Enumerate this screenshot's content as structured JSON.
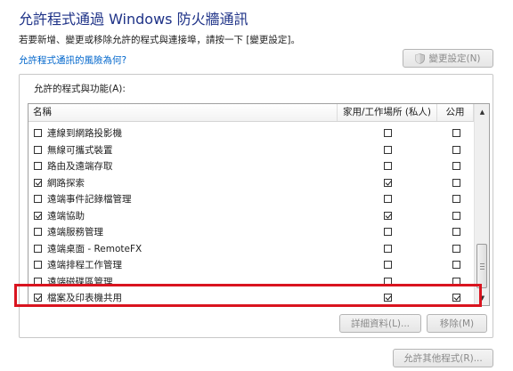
{
  "header": {
    "title": "允許程式通過 Windows 防火牆通訊",
    "subtitle": "若要新增、變更或移除允許的程式與連接埠，請按一下 [變更設定]。",
    "risk_link": "允許程式通訊的風險為何?",
    "change_settings_label": "變更設定(N)"
  },
  "group": {
    "label": "允許的程式與功能(A):",
    "columns": {
      "name": "名稱",
      "private": "家用/工作場所 (私人)",
      "public": "公用"
    },
    "rows": [
      {
        "label": "連線到網路投影機",
        "enabled": false,
        "private": false,
        "public": false
      },
      {
        "label": "無線可攜式裝置",
        "enabled": false,
        "private": false,
        "public": false
      },
      {
        "label": "路由及遠端存取",
        "enabled": false,
        "private": false,
        "public": false
      },
      {
        "label": "網路探索",
        "enabled": true,
        "private": true,
        "public": false
      },
      {
        "label": "遠端事件記錄檔管理",
        "enabled": false,
        "private": false,
        "public": false
      },
      {
        "label": "遠端協助",
        "enabled": true,
        "private": true,
        "public": false
      },
      {
        "label": "遠端服務管理",
        "enabled": false,
        "private": false,
        "public": false
      },
      {
        "label": "遠端桌面 - RemoteFX",
        "enabled": false,
        "private": false,
        "public": false
      },
      {
        "label": "遠端排程工作管理",
        "enabled": false,
        "private": false,
        "public": false
      },
      {
        "label": "遠端磁碟區管理",
        "enabled": false,
        "private": false,
        "public": false
      },
      {
        "label": "檔案及印表機共用",
        "enabled": true,
        "private": true,
        "public": true
      }
    ],
    "details_label": "詳細資料(L)...",
    "remove_label": "移除(M)"
  },
  "footer": {
    "allow_other_label": "允許其他程式(R)..."
  },
  "colors": {
    "title": "#1e3287",
    "link": "#0066cc",
    "highlight": "#d9141f"
  }
}
